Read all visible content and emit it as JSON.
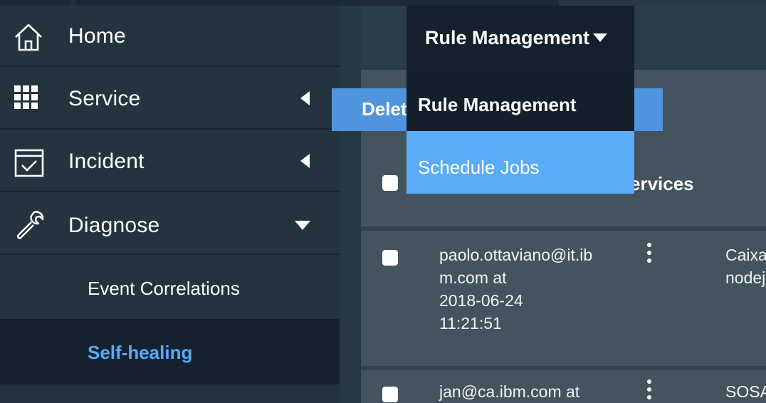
{
  "sidebar": {
    "items": [
      {
        "label": "Home",
        "icon": "home-icon"
      },
      {
        "label": "Service",
        "icon": "grid-icon",
        "chevron": "chevron-left-icon"
      },
      {
        "label": "Incident",
        "icon": "calendar-check-icon",
        "chevron": "chevron-left-icon"
      },
      {
        "label": "Diagnose",
        "icon": "wrench-icon",
        "chevron": "chevron-down-icon"
      }
    ],
    "subitems": [
      {
        "label": "Event Correlations",
        "active": false
      },
      {
        "label": "Self-healing",
        "active": true
      }
    ]
  },
  "dropdown": {
    "selected": "Rule Management",
    "options": [
      "Rule Management",
      "Schedule Jobs"
    ],
    "highlighted": "Schedule Jobs"
  },
  "toolbar": {
    "delete_label": "Delete"
  },
  "table": {
    "header_partial": "ervices",
    "rows": [
      {
        "created": [
          "paolo.ottaviano@it.ib",
          "m.com at",
          "2018-06-24",
          "11:21:51"
        ],
        "service": [
          "Caixa",
          "nodejs"
        ]
      },
      {
        "created": [
          "jan@ca.ibm.com at"
        ],
        "service": [
          "SOSA"
        ]
      }
    ]
  },
  "colors": {
    "sidebar_bg": "#24343f",
    "active_sub_bg": "#15222d",
    "active_text": "#5aa8ff",
    "accent_blue": "#4f94dc",
    "dropdown_bg": "#14212c",
    "highlight_bg": "#5aabf8"
  }
}
